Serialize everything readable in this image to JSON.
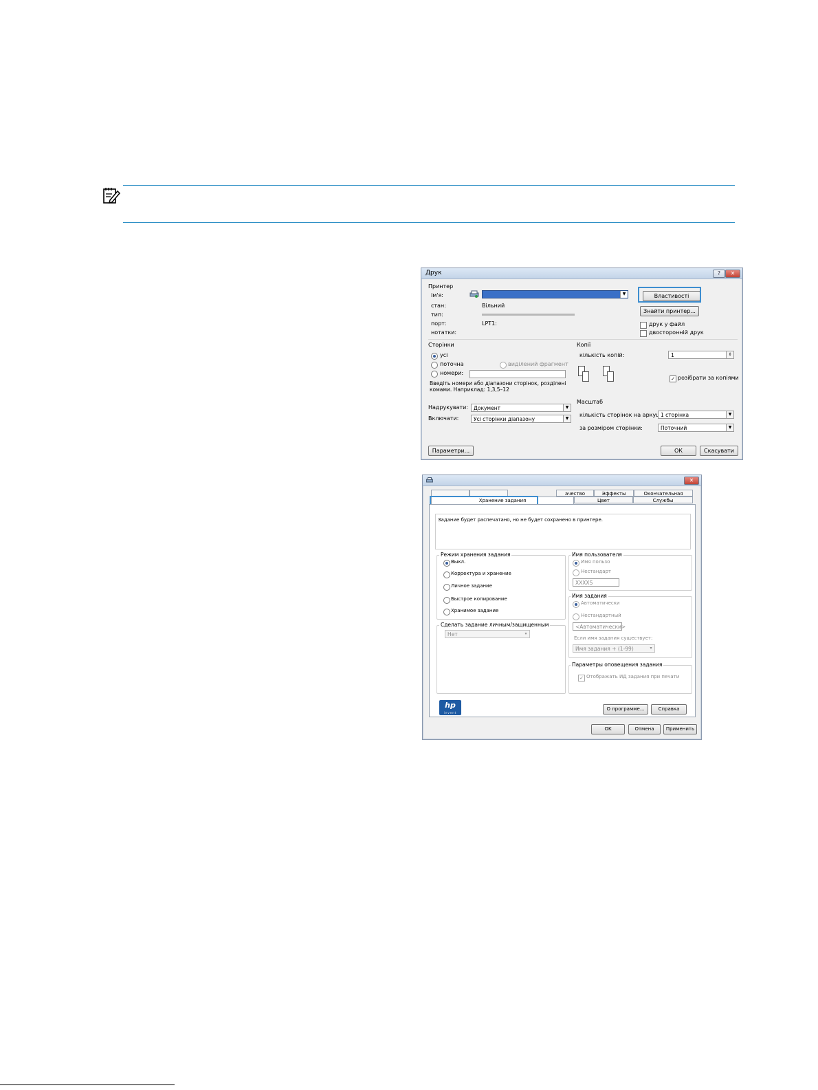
{
  "print_dialog": {
    "title": "Друк",
    "help_button": "?",
    "close_button": "✕",
    "printer_group": "Принтер",
    "name_label": "ім'я:",
    "status_label": "стан:",
    "status_value": "Вільний",
    "type_label": "тип:",
    "port_label": "порт:",
    "port_value": "LPT1:",
    "comment_label": "нотатки:",
    "properties_button": "Властивості",
    "find_printer_button": "Знайти принтер...",
    "print_to_file": "друк у файл",
    "duplex": "двосторонній друк",
    "pages_group": "Сторінки",
    "all": "усі",
    "current": "поточна",
    "selection": "виділений фрагмент",
    "pages": "номери:",
    "pages_hint": "Введіть номери або діапазони сторінок, розділені комами. Наприклад: 1,3,5–12",
    "copies_group": "Копії",
    "copies_label": "кількість копій:",
    "copies_value": "1",
    "collate": "розібрати за копіями",
    "print_what_label": "Надрукувати:",
    "print_what_value": "Документ",
    "include_label": "Включати:",
    "include_value": "Усі сторінки діапазону",
    "zoom_group": "Масштаб",
    "pages_per_sheet_label": "кількість сторінок на аркуші:",
    "pages_per_sheet_value": "1 сторінка",
    "scale_label": "за розміром сторінки:",
    "scale_value": "Поточний",
    "options_button": "Параметри...",
    "ok_button": "ОК",
    "cancel_button": "Скасувати"
  },
  "job_dialog": {
    "close_button": "✕",
    "tabs_top": [
      "",
      "",
      "ачество",
      "Эффекты",
      "Окончательная обработка"
    ],
    "tabs_bottom": [
      "Хранение задания",
      "Цвет",
      "Службы"
    ],
    "info_text": "Задание будет распечатано, но не будет сохранено в принтере.",
    "mode_group": "Режим хранения задания",
    "mode_options": [
      "Выкл.",
      "Корректура и хранение",
      "Личное задание",
      "Быстрое копирование",
      "Хранимое задание"
    ],
    "private_group": "Сделать задание личным/защищенным",
    "private_value": "Нет",
    "user_group": "Имя пользователя",
    "user_options": [
      "Имя пользо",
      "Нестандарт"
    ],
    "user_value": "XXXXS",
    "jobname_group": "Имя задания",
    "jobname_options": [
      "Автоматически",
      "Нестандартный"
    ],
    "jobname_value": "<Автоматически>",
    "exists_label": "Если имя задания существует:",
    "exists_value": "Имя задания + (1-99)",
    "notify_group": "Параметры оповещения задания",
    "notify_option": "Отображать ИД задания при печати",
    "logo_text": "hp",
    "logo_sub": "invent",
    "about_button": "О программе...",
    "help_button": "Справка",
    "ok_button": "OK",
    "cancel_button": "Отмена",
    "apply_button": "Применить"
  }
}
